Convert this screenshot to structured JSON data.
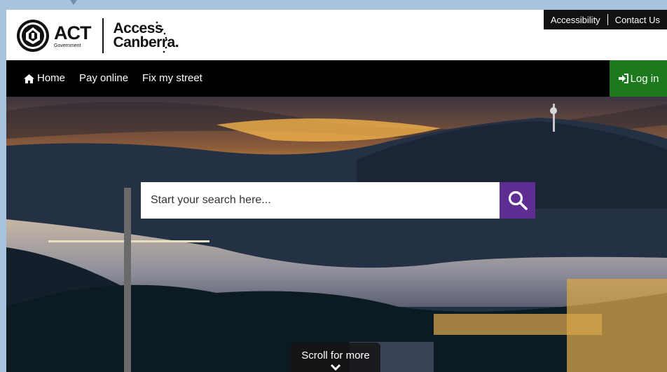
{
  "header": {
    "logo_act": "ACT",
    "logo_government": "Government",
    "logo_access": "Access",
    "logo_canberra": "Canberra."
  },
  "utility_links": {
    "accessibility": "Accessibility",
    "contact": "Contact Us"
  },
  "nav": {
    "home": "Home",
    "pay_online": "Pay online",
    "fix_street": "Fix my street",
    "login": "Log in"
  },
  "search": {
    "placeholder": "Start your search here..."
  },
  "scroll": {
    "label": "Scroll for more"
  },
  "colors": {
    "nav_bg": "#000000",
    "login_bg": "#1c7a1c",
    "search_button": "#5d2d91"
  },
  "icons": {
    "home": "home-icon",
    "login": "sign-in-icon",
    "search": "search-icon",
    "scroll": "chevron-down-icon"
  }
}
